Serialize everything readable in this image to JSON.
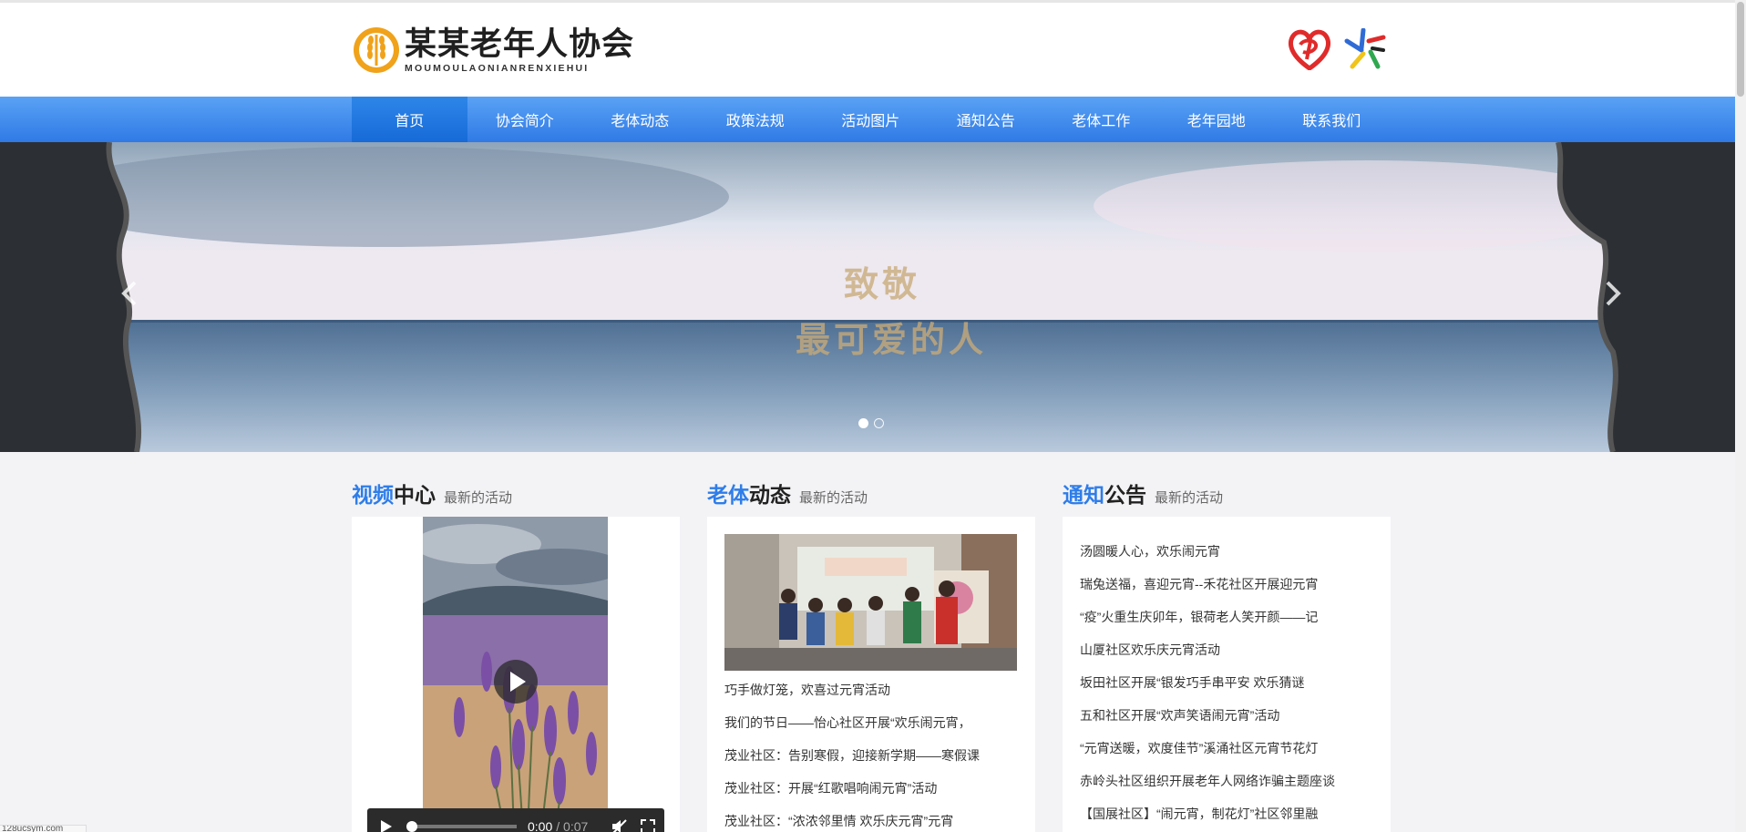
{
  "header": {
    "logo_title": "某某老年人协会",
    "logo_subtitle": "MOUMOULAONIANRENXIEHUI"
  },
  "nav": {
    "items": [
      "首页",
      "协会简介",
      "老体动态",
      "政策法规",
      "活动图片",
      "通知公告",
      "老体工作",
      "老年园地",
      "联系我们"
    ],
    "active_index": 0
  },
  "banner": {
    "line1": "致敬",
    "line2": "最可爱的人",
    "slide_count": 2,
    "active_slide": 0
  },
  "video_section": {
    "title_accent": "视频",
    "title_main": "中心",
    "subtitle": "最新的活动",
    "current_time": "0:00",
    "duration": "/ 0:07"
  },
  "news_section": {
    "title_accent": "老体",
    "title_main": "动态",
    "subtitle": "最新的活动",
    "items": [
      "巧手做灯笼，欢喜过元宵活动",
      "我们的节日——怡心社区开展“欢乐闹元宵，",
      "茂业社区：告别寒假，迎接新学期——寒假课",
      "茂业社区：开展“红歌唱响闹元宵”活动",
      "茂业社区：“浓浓邻里情 欢乐庆元宵”元宵"
    ]
  },
  "notice_section": {
    "title_accent": "通知",
    "title_main": "公告",
    "subtitle": "最新的活动",
    "items": [
      "汤圆暖人心，欢乐闹元宵",
      "瑞兔送福，喜迎元宵--禾花社区开展迎元宵",
      "“疫”火重生庆卯年，银荷老人笑开颜——记",
      "山厦社区欢乐庆元宵活动",
      "坂田社区开展“银发巧手串平安 欢乐猜谜",
      "五和社区开展“欢声笑语闹元宵”活动",
      "“元宵送暖，欢度佳节”溪涌社区元宵节花灯",
      "赤岭头社区组织开展老年人网络诈骗主题座谈",
      "【国展社区】“闹元宵，制花灯”社区邻里融"
    ]
  },
  "status_bar": {
    "text": "128ucsym.com"
  },
  "colors": {
    "accent": "#2e7de9",
    "nav_top": "#5aa2f5",
    "nav_bottom": "#2f7ae6",
    "logo_gold": "#f0a21a"
  },
  "icons": [
    "wheat-emblem-icon",
    "charity-heart-icon",
    "star-emblem-icon",
    "chevron-left-icon",
    "chevron-right-icon",
    "play-icon",
    "mute-icon",
    "fullscreen-icon"
  ]
}
